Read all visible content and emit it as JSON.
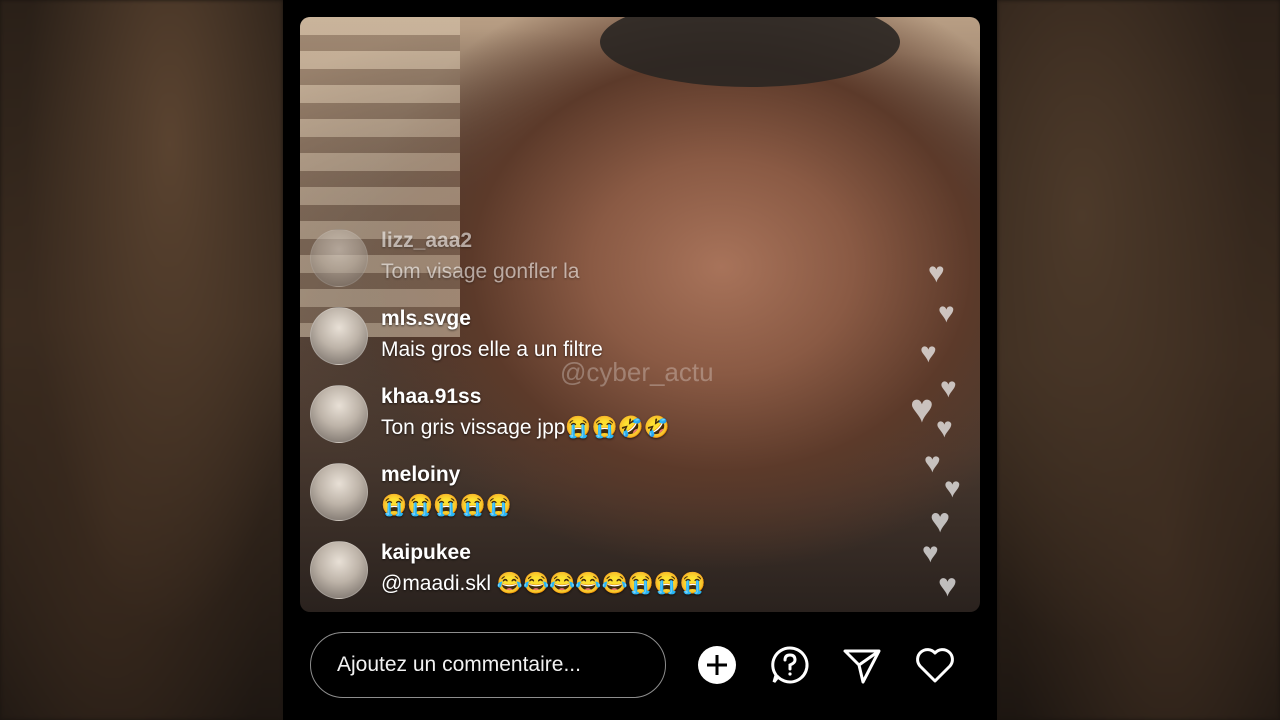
{
  "video": {
    "watermark": "@cyber_actu"
  },
  "comments": [
    {
      "user": "lizz_aaa2",
      "text": "Tom visage gonfler la"
    },
    {
      "user": "mls.svge",
      "text": "Mais gros elle a un filtre"
    },
    {
      "user": "khaa.91ss",
      "text": "Ton gris vissage jpp😭😭🤣🤣"
    },
    {
      "user": "meloiny",
      "text": "😭😭😭😭😭"
    },
    {
      "user": "kaipukee",
      "text": "@maadi.skl 😂😂😂😂😂😭😭😭"
    }
  ],
  "bottom_bar": {
    "comment_placeholder": "Ajoutez un commentaire...",
    "icons": [
      "plus-circle-icon",
      "question-bubble-icon",
      "send-icon",
      "heart-icon"
    ]
  },
  "colors": {
    "background": "#000000",
    "text": "#ffffff",
    "input_border": "#8e8e8e"
  }
}
